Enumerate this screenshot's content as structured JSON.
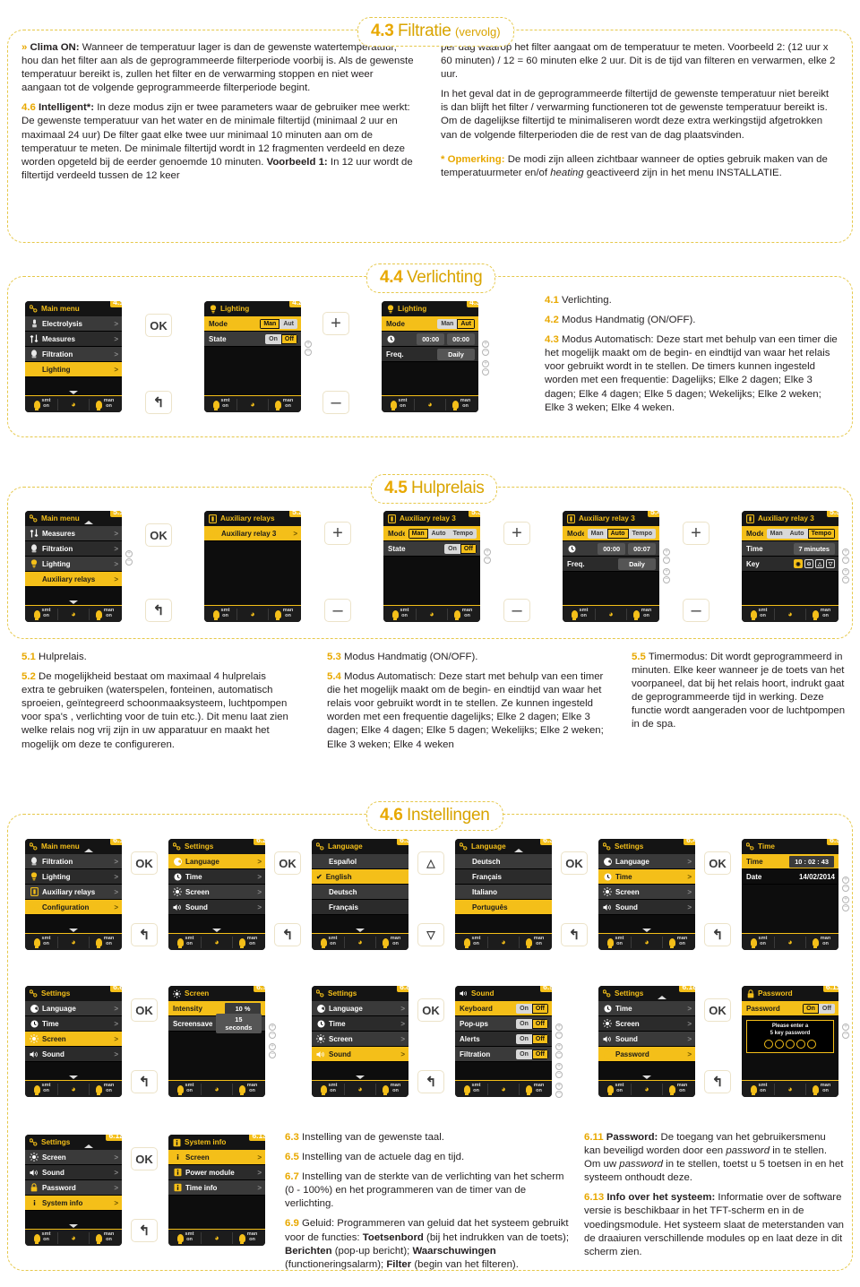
{
  "sections": {
    "s43": {
      "num": "4.3",
      "title": "Filtratie",
      "sub": "(vervolg)"
    },
    "s44": {
      "num": "4.4",
      "title": "Verlichting",
      "sub": ""
    },
    "s45": {
      "num": "4.5",
      "title": "Hulprelais",
      "sub": ""
    },
    "s46": {
      "num": "4.6",
      "title": "Instellingen",
      "sub": ""
    }
  },
  "s43_text": {
    "left": [
      {
        "chev": "»",
        "lbl": "",
        "html": "Clima ON: Wanneer de temperatuur lager is dan de gewenste watertemperatuur, hou dan het filter aan als de geprogrammeerde filterperiode voorbij is. Als de gewenste temperatuur bereikt is, zullen het filter en de verwarming stoppen en niet weer aangaan tot de volgende geprogrammeerde filterperiode begint."
      },
      {
        "lbl": "4.6",
        "html": "Intelligent*: In deze modus zijn er twee parameters waar de gebruiker mee werkt: De gewenste temperatuur van het water en de minimale filtertijd (minimaal 2 uur en maximaal 24 uur) De filter gaat elke twee uur minimaal 10 minuten aan om de temperatuur te meten. De minimale filtertijd wordt in 12 fragmenten verdeeld en deze worden opgeteld bij de eerder genoemde 10 minuten. Voorbeeld 1: In 12 uur wordt de filtertijd verdeeld tussen de 12 keer"
      }
    ],
    "right": [
      "per dag waarop het filter aangaat om de temperatuur te meten. Voorbeeld 2: (12 uur x 60 minuten) / 12 = 60 minuten elke 2 uur. Dit is de tijd van filteren en verwarmen, elke 2 uur.",
      "In het geval dat in de geprogrammeerde filtertijd de gewenste temperatuur niet bereikt is dan blijft het filter / verwarming functioneren tot de gewenste temperatuur bereikt is. Om de dagelijkse filtertijd te minimaliseren wordt deze extra werkingstijd afgetrokken van de volgende filterperioden die de rest van de dag plaatsvinden."
    ],
    "note_lbl": "* Opmerking:",
    "note": "De modi zijn alleen zichtbaar wanneer de opties gebruik maken van de temperatuurmeter en/of heating geactiveerd zijn in het menu INSTALLATIE."
  },
  "s44_text": [
    {
      "lbl": "4.1",
      "body": "Verlichting."
    },
    {
      "lbl": "4.2",
      "body": "Modus Handmatig (ON/OFF)."
    },
    {
      "lbl": "4.3",
      "body": "Modus Automatisch: Deze start met behulp van een timer die het mogelijk maakt om de begin- en eindtijd van waar het relais voor gebruikt wordt in te stellen. De timers kunnen ingesteld worden met een frequentie: Dagelijks; Elke 2 dagen; Elke 3 dagen; Elke 4 dagen; Elke 5 dagen; Wekelijks; Elke 2 weken; Elke 3 weken; Elke 4 weken."
    }
  ],
  "s45_text_c1": [
    {
      "lbl": "5.1",
      "body": "Hulprelais."
    },
    {
      "lbl": "5.2",
      "body": "De mogelijkheid bestaat om maximaal 4 hulprelais extra te gebruiken (waterspelen, fonteinen, automatisch sproeien, geïntegreerd schoonmaaksysteem, luchtpompen voor spa's , verlichting voor de tuin etc.). Dit menu laat zien welke relais nog vrij zijn in uw apparatuur en maakt het mogelijk om deze te configureren."
    }
  ],
  "s45_text_c2": [
    {
      "lbl": "5.3",
      "body": "Modus Handmatig (ON/OFF)."
    },
    {
      "lbl": "5.4",
      "body": "Modus Automatisch: Deze start met behulp van een timer die het mogelijk maakt om de begin- en eindtijd van waar het relais voor gebruikt wordt in te stellen. Ze kunnen ingesteld worden met een frequentie dagelijks; Elke 2 dagen; Elke 3 dagen; Elke 4 dagen; Elke 5 dagen; Wekelijks; Elke 2 weken; Elke 3 weken; Elke 4 weken"
    }
  ],
  "s45_text_c3": [
    {
      "lbl": "5.5",
      "body": "Timermodus: Dit wordt geprogrammeerd in minuten. Elke keer wanneer je de toets van het voorpaneel, dat bij het relais hoort, indrukt gaat de geprogrammeerde tijd in werking. Deze functie wordt aangeraden voor de luchtpompen in de spa."
    }
  ],
  "s46_text_c1": [
    {
      "lbl": "6.3",
      "body": "Instelling van de gewenste taal."
    },
    {
      "lbl": "6.5",
      "body": "Instelling van de actuele dag en tijd."
    },
    {
      "lbl": "6.7",
      "body": "Instelling van de sterkte van de verlichting van het scherm (0 - 100%) en het programmeren van de timer van de verlichting."
    },
    {
      "lbl": "6.9",
      "body": "Geluid: Programmeren van geluid dat het systeem gebruikt voor de functies: Toetsenbord (bij het indrukken van de toets); Berichten (pop-up bericht); Waarschuwingen (functioneringsalarm); Filter (begin van het filteren)."
    }
  ],
  "s46_text_c2": [
    {
      "lbl": "6.11",
      "body": "Password: De toegang van het gebruikersmenu kan beveiligd worden door een password in te stellen. Om uw password in te stellen, toetst u 5 toetsen in en het systeem onthoudt deze."
    },
    {
      "lbl": "6.13",
      "body": "Info over het systeem: Informatie over de software versie is beschikbaar in het TFT-scherm en in de voedingsmodule. Het systeem slaat de meterstanden van de draaiuren verschillende modules op en laat deze in dit scherm zien."
    }
  ],
  "buttons": {
    "ok": "OK",
    "plus": "+",
    "minus": "–",
    "back": "↰",
    "up": "△",
    "down": "▽"
  },
  "statusbar": {
    "smt": "smt",
    "smt2": "on",
    "man": "man",
    "man2": "on"
  },
  "panels": {
    "p41": {
      "badge": "4.1",
      "title": "Main menu",
      "icon": "settings-icon",
      "rows": [
        {
          "label": "Electrolysis",
          "icon": "electrode-icon",
          "chev": ">",
          "style": "dark"
        },
        {
          "label": "Measures",
          "icon": "measures-icon",
          "chev": ">",
          "style": "darker"
        },
        {
          "label": "Filtration",
          "icon": "filter-icon",
          "chev": ">",
          "style": "dark"
        },
        {
          "label": "Lighting",
          "icon": "bulb-icon",
          "chev": ">",
          "style": "sel"
        }
      ],
      "scroll_down": true
    },
    "p42": {
      "badge": "4.2",
      "title": "Lighting",
      "icon": "bulb-icon",
      "rows": [
        {
          "label": "Mode",
          "style": "sel",
          "seg": [
            "Man",
            "Aut"
          ],
          "segSel": 0
        },
        {
          "label": "State",
          "style": "dark",
          "seg": [
            "On",
            "Off"
          ],
          "segSel": 1
        }
      ],
      "knobs_at": [
        1
      ]
    },
    "p43": {
      "badge": "4.3",
      "title": "Lighting",
      "icon": "bulb-icon",
      "rows": [
        {
          "label": "Mode",
          "style": "sel",
          "seg": [
            "Man",
            "Aut"
          ],
          "segSel": 1
        },
        {
          "label": "",
          "icon": "clock-icon",
          "style": "dark",
          "vals": [
            "00:00",
            "00:00"
          ]
        },
        {
          "label": "Freq.",
          "style": "darker",
          "valbox": "Daily"
        }
      ]
    },
    "p51": {
      "badge": "5.1",
      "title": "Main menu",
      "icon": "settings-icon",
      "scroll_up": true,
      "rows": [
        {
          "label": "Measures",
          "icon": "measures-icon",
          "chev": ">",
          "style": "dark"
        },
        {
          "label": "Filtration",
          "icon": "filter-icon",
          "chev": ">",
          "style": "darker"
        },
        {
          "label": "Lighting",
          "icon": "bulb-icon",
          "chev": ">",
          "style": "dark"
        },
        {
          "label": "Auxiliary relays",
          "icon": "relay-icon",
          "chev": ">",
          "style": "sel"
        }
      ],
      "scroll_down": true
    },
    "p52": {
      "badge": "5.2",
      "title": "Auxiliary relays",
      "icon": "relay-icon",
      "rows": [
        {
          "label": "Auxiliary relay 3",
          "icon": "relay-icon",
          "chev": ">",
          "style": "sel"
        }
      ]
    },
    "p53": {
      "badge": "5.3",
      "title": "Auxiliary relay 3",
      "icon": "relay-icon",
      "rows": [
        {
          "label": "Mode",
          "style": "sel",
          "seg": [
            "Man",
            "Auto",
            "Tempo"
          ],
          "segSel": 0
        },
        {
          "label": "State",
          "style": "dark",
          "seg": [
            "On",
            "Off"
          ],
          "segSel": 1
        }
      ]
    },
    "p54": {
      "badge": "5.4",
      "title": "Auxiliary relay 3",
      "icon": "relay-icon",
      "rows": [
        {
          "label": "Mode",
          "style": "sel",
          "seg": [
            "Man",
            "Auto",
            "Tempo"
          ],
          "segSel": 1
        },
        {
          "label": "",
          "icon": "clock-icon",
          "style": "dark",
          "vals": [
            "00:00",
            "00:07"
          ]
        },
        {
          "label": "Freq.",
          "style": "darker",
          "valbox": "Daily"
        }
      ]
    },
    "p55": {
      "badge": "5.5",
      "title": "Auxiliary relay 3",
      "icon": "relay-icon",
      "rows": [
        {
          "label": "Mode",
          "style": "sel",
          "seg": [
            "Man",
            "Auto",
            "Tempo"
          ],
          "segSel": 2
        },
        {
          "label": "Time",
          "style": "dark",
          "valbox": "7 minutes"
        },
        {
          "label": "Key",
          "style": "darker",
          "keys": [
            "◉",
            "⊖",
            "△",
            "▽"
          ],
          "keySel": 0
        }
      ]
    },
    "p61": {
      "badge": "6.1",
      "title": "Main menu",
      "icon": "settings-icon",
      "scroll_up": true,
      "rows": [
        {
          "label": "Filtration",
          "icon": "filter-icon",
          "chev": ">",
          "style": "dark"
        },
        {
          "label": "Lighting",
          "icon": "bulb-icon",
          "chev": ">",
          "style": "darker"
        },
        {
          "label": "Auxiliary relays",
          "icon": "relay-icon",
          "chev": ">",
          "style": "dark"
        },
        {
          "label": "Configuration",
          "icon": "settings-icon",
          "chev": ">",
          "style": "sel"
        }
      ],
      "scroll_down": true
    },
    "p62": {
      "badge": "6.2",
      "title": "Settings",
      "icon": "settings-icon",
      "rows": [
        {
          "label": "Language",
          "icon": "globe-icon",
          "chev": ">",
          "style": "sel"
        },
        {
          "label": "Time",
          "icon": "clock-icon",
          "chev": ">",
          "style": "darker"
        },
        {
          "label": "Screen",
          "icon": "brightness-icon",
          "chev": ">",
          "style": "dark"
        },
        {
          "label": "Sound",
          "icon": "speaker-icon",
          "chev": ">",
          "style": "darker"
        }
      ],
      "scroll_down": true
    },
    "p63a": {
      "badge": "6.3",
      "title": "Language",
      "icon": "settings-icon",
      "rows": [
        {
          "label": "Español",
          "style": "dark",
          "indent": true
        },
        {
          "label": "English",
          "style": "sel",
          "check": "✔"
        },
        {
          "label": "Deutsch",
          "style": "dark",
          "indent": true
        },
        {
          "label": "Français",
          "style": "darker",
          "indent": true
        }
      ],
      "scroll_down": true
    },
    "p63b": {
      "badge": "6.3",
      "title": "Language",
      "icon": "settings-icon",
      "scroll_up": true,
      "rows": [
        {
          "label": "Deutsch",
          "style": "dark",
          "indent": true
        },
        {
          "label": "Français",
          "style": "darker",
          "indent": true
        },
        {
          "label": "Italiano",
          "style": "dark",
          "indent": true
        },
        {
          "label": "Português",
          "style": "sel",
          "indent": true
        }
      ]
    },
    "p64": {
      "badge": "6.4",
      "title": "Settings",
      "icon": "settings-icon",
      "rows": [
        {
          "label": "Language",
          "icon": "globe-icon",
          "chev": ">",
          "style": "dark"
        },
        {
          "label": "Time",
          "icon": "clock-icon",
          "chev": ">",
          "style": "sel"
        },
        {
          "label": "Screen",
          "icon": "brightness-icon",
          "chev": ">",
          "style": "dark"
        },
        {
          "label": "Sound",
          "icon": "speaker-icon",
          "chev": ">",
          "style": "darker"
        }
      ],
      "scroll_down": true
    },
    "p65": {
      "badge": "6.5",
      "title": "Time",
      "icon": "settings-icon",
      "rows": [
        {
          "label": "Time",
          "style": "sel",
          "valbox": "10 : 02 : 43",
          "hl": true
        },
        {
          "label": "Date",
          "style": "black",
          "plain": "14/02/2014"
        }
      ]
    },
    "p66": {
      "badge": "6.6",
      "title": "Settings",
      "icon": "settings-icon",
      "rows": [
        {
          "label": "Language",
          "icon": "globe-icon",
          "chev": ">",
          "style": "dark"
        },
        {
          "label": "Time",
          "icon": "clock-icon",
          "chev": ">",
          "style": "darker"
        },
        {
          "label": "Screen",
          "icon": "brightness-icon",
          "chev": ">",
          "style": "sel"
        },
        {
          "label": "Sound",
          "icon": "speaker-icon",
          "chev": ">",
          "style": "darker"
        }
      ],
      "scroll_down": true
    },
    "p67": {
      "badge": "6.7",
      "title": "Screen",
      "icon": "brightness-icon",
      "rows": [
        {
          "label": "Intensity",
          "style": "sel",
          "valbox": "10 %",
          "hl": true
        },
        {
          "label": "Screensave",
          "style": "dark",
          "valbox": "15 seconds"
        }
      ]
    },
    "p68": {
      "badge": "6.8",
      "title": "Settings",
      "icon": "settings-icon",
      "rows": [
        {
          "label": "Language",
          "icon": "globe-icon",
          "chev": ">",
          "style": "dark"
        },
        {
          "label": "Time",
          "icon": "clock-icon",
          "chev": ">",
          "style": "darker"
        },
        {
          "label": "Screen",
          "icon": "brightness-icon",
          "chev": ">",
          "style": "dark"
        },
        {
          "label": "Sound",
          "icon": "speaker-icon",
          "chev": ">",
          "style": "sel"
        }
      ],
      "scroll_down": true
    },
    "p69": {
      "badge": "6.9",
      "title": "Sound",
      "icon": "speaker-icon",
      "rows": [
        {
          "label": "Keyboard",
          "style": "sel",
          "seg": [
            "On",
            "Off"
          ],
          "segSel": 1
        },
        {
          "label": "Pop-ups",
          "style": "dark",
          "seg": [
            "On",
            "Off"
          ],
          "segSel": 1
        },
        {
          "label": "Alerts",
          "style": "darker",
          "seg": [
            "On",
            "Off"
          ],
          "segSel": 1
        },
        {
          "label": "Filtration",
          "style": "dark",
          "seg": [
            "On",
            "Off"
          ],
          "segSel": 1
        }
      ]
    },
    "p610": {
      "badge": "6.10",
      "title": "Settings",
      "icon": "settings-icon",
      "scroll_up": true,
      "rows": [
        {
          "label": "Time",
          "icon": "clock-icon",
          "chev": ">",
          "style": "dark"
        },
        {
          "label": "Screen",
          "icon": "brightness-icon",
          "chev": ">",
          "style": "darker"
        },
        {
          "label": "Sound",
          "icon": "speaker-icon",
          "chev": ">",
          "style": "dark"
        },
        {
          "label": "Password",
          "icon": "lock-icon",
          "chev": ">",
          "style": "sel"
        }
      ],
      "scroll_down": true
    },
    "p611": {
      "badge": "6.11",
      "title": "Password",
      "icon": "lock-icon",
      "rows": [
        {
          "label": "Password",
          "style": "sel",
          "seg": [
            "On",
            "Off"
          ],
          "segSel": 0
        }
      ],
      "pw": {
        "line1": "Please enter a",
        "line2": "5 key password",
        "dots": 5
      }
    },
    "p612": {
      "badge": "6.12",
      "title": "Settings",
      "icon": "settings-icon",
      "scroll_up": true,
      "rows": [
        {
          "label": "Screen",
          "icon": "brightness-icon",
          "chev": ">",
          "style": "dark"
        },
        {
          "label": "Sound",
          "icon": "speaker-icon",
          "chev": ">",
          "style": "darker"
        },
        {
          "label": "Password",
          "icon": "lock-icon",
          "chev": ">",
          "style": "dark"
        },
        {
          "label": "System info",
          "icon": "info-icon",
          "chev": ">",
          "style": "sel"
        }
      ],
      "scroll_down": true
    },
    "p613": {
      "badge": "6.13",
      "title": "System info",
      "icon": "info-icon",
      "rows": [
        {
          "label": "Screen",
          "icon": "info-icon",
          "chev": ">",
          "style": "sel"
        },
        {
          "label": "Power module",
          "icon": "info-icon",
          "chev": ">",
          "style": "darker"
        },
        {
          "label": "Time info",
          "icon": "info-icon",
          "chev": ">",
          "style": "dark"
        }
      ]
    }
  }
}
